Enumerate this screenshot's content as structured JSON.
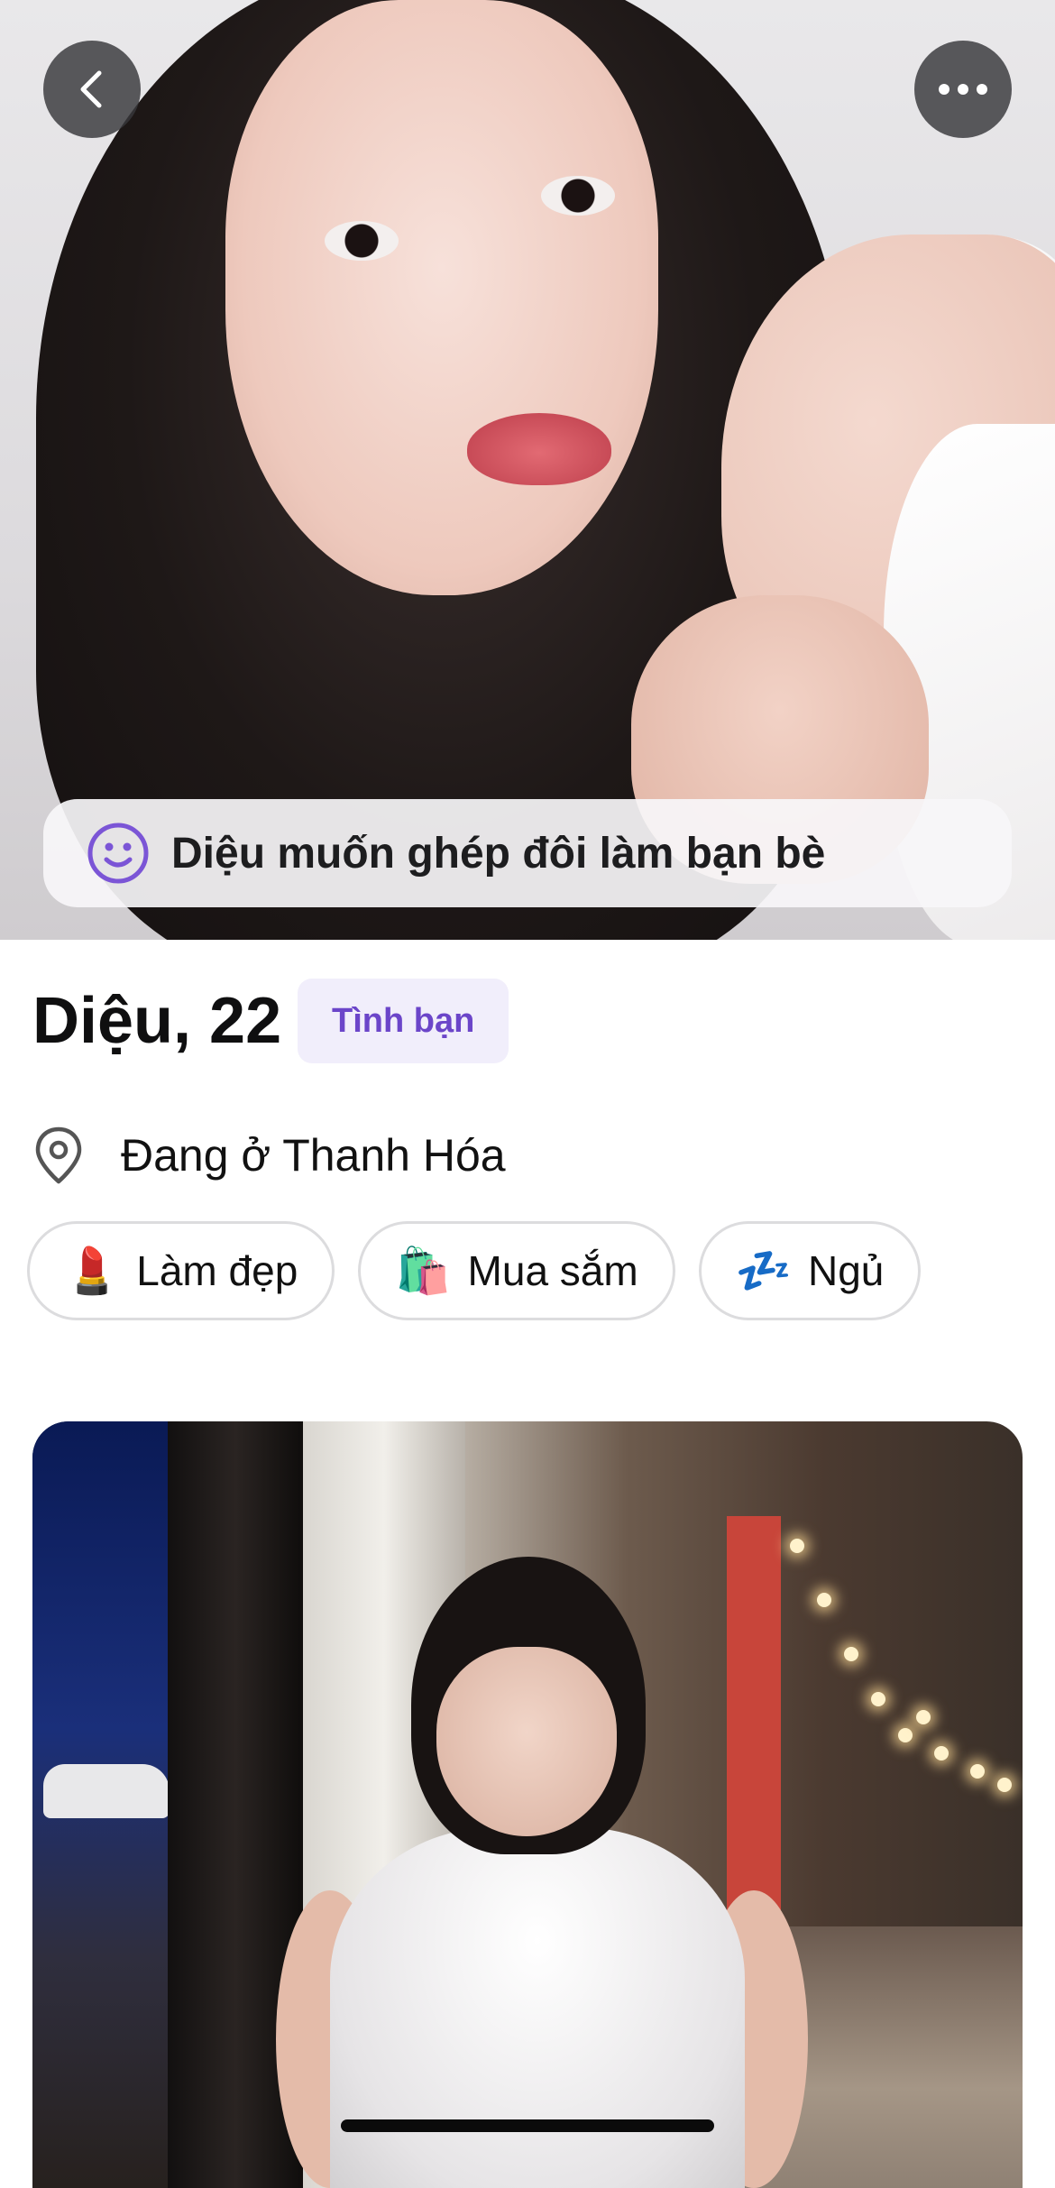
{
  "header": {
    "back_icon": "chevron-left-icon",
    "more_icon": "ellipsis-icon"
  },
  "intent": {
    "icon": "smile-icon",
    "text": "Diệu muốn ghép đôi làm bạn bè",
    "color": "#7b55d6"
  },
  "profile": {
    "name_age": "Diệu, 22",
    "badge": "Tình bạn",
    "badge_color": "#6b45c9",
    "location_icon": "location-pin-icon",
    "location": "Đang ở Thanh Hóa"
  },
  "interests": [
    {
      "emoji": "💄",
      "label": "Làm đẹp"
    },
    {
      "emoji": "🛍️",
      "label": "Mua sắm"
    },
    {
      "emoji": "💤",
      "label": "Ngủ"
    }
  ]
}
